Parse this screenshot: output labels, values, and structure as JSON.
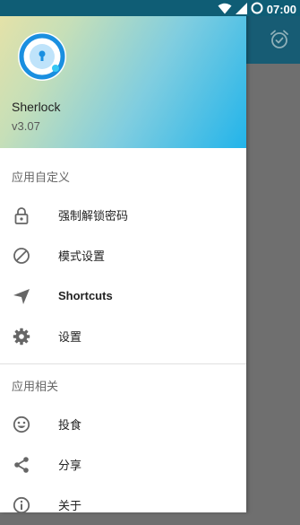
{
  "status_bar": {
    "time": "07:00"
  },
  "drawer": {
    "app_name": "Sherlock",
    "version": "v3.07",
    "sections": [
      {
        "title": "应用自定义",
        "items": [
          {
            "label": "强制解锁密码",
            "icon": "lock-icon"
          },
          {
            "label": "模式设置",
            "icon": "block-icon"
          },
          {
            "label": "Shortcuts",
            "icon": "send-icon"
          },
          {
            "label": "设置",
            "icon": "gear-icon"
          }
        ]
      },
      {
        "title": "应用相关",
        "items": [
          {
            "label": "投食",
            "icon": "smiley-icon"
          },
          {
            "label": "分享",
            "icon": "share-icon"
          },
          {
            "label": "关于",
            "icon": "info-icon"
          }
        ]
      }
    ]
  },
  "colors": {
    "status_bar": "#0f5d75",
    "app_bar": "#175c74",
    "scrim": "#6f6f6f",
    "icon_gray": "#666666"
  }
}
